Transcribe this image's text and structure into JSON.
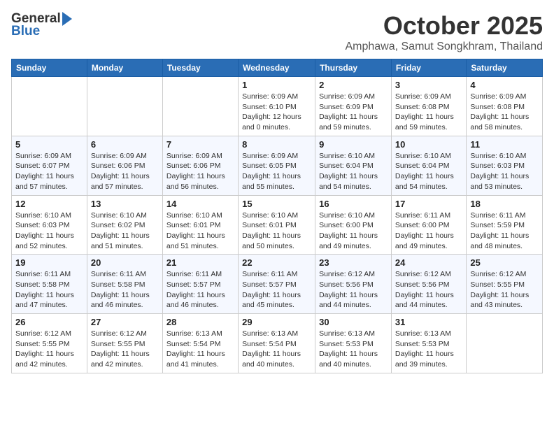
{
  "header": {
    "logo_general": "General",
    "logo_blue": "Blue",
    "month": "October 2025",
    "location": "Amphawa, Samut Songkhram, Thailand"
  },
  "weekdays": [
    "Sunday",
    "Monday",
    "Tuesday",
    "Wednesday",
    "Thursday",
    "Friday",
    "Saturday"
  ],
  "weeks": [
    [
      {
        "day": "",
        "info": ""
      },
      {
        "day": "",
        "info": ""
      },
      {
        "day": "",
        "info": ""
      },
      {
        "day": "1",
        "info": "Sunrise: 6:09 AM\nSunset: 6:10 PM\nDaylight: 12 hours\nand 0 minutes."
      },
      {
        "day": "2",
        "info": "Sunrise: 6:09 AM\nSunset: 6:09 PM\nDaylight: 11 hours\nand 59 minutes."
      },
      {
        "day": "3",
        "info": "Sunrise: 6:09 AM\nSunset: 6:08 PM\nDaylight: 11 hours\nand 59 minutes."
      },
      {
        "day": "4",
        "info": "Sunrise: 6:09 AM\nSunset: 6:08 PM\nDaylight: 11 hours\nand 58 minutes."
      }
    ],
    [
      {
        "day": "5",
        "info": "Sunrise: 6:09 AM\nSunset: 6:07 PM\nDaylight: 11 hours\nand 57 minutes."
      },
      {
        "day": "6",
        "info": "Sunrise: 6:09 AM\nSunset: 6:06 PM\nDaylight: 11 hours\nand 57 minutes."
      },
      {
        "day": "7",
        "info": "Sunrise: 6:09 AM\nSunset: 6:06 PM\nDaylight: 11 hours\nand 56 minutes."
      },
      {
        "day": "8",
        "info": "Sunrise: 6:09 AM\nSunset: 6:05 PM\nDaylight: 11 hours\nand 55 minutes."
      },
      {
        "day": "9",
        "info": "Sunrise: 6:10 AM\nSunset: 6:04 PM\nDaylight: 11 hours\nand 54 minutes."
      },
      {
        "day": "10",
        "info": "Sunrise: 6:10 AM\nSunset: 6:04 PM\nDaylight: 11 hours\nand 54 minutes."
      },
      {
        "day": "11",
        "info": "Sunrise: 6:10 AM\nSunset: 6:03 PM\nDaylight: 11 hours\nand 53 minutes."
      }
    ],
    [
      {
        "day": "12",
        "info": "Sunrise: 6:10 AM\nSunset: 6:03 PM\nDaylight: 11 hours\nand 52 minutes."
      },
      {
        "day": "13",
        "info": "Sunrise: 6:10 AM\nSunset: 6:02 PM\nDaylight: 11 hours\nand 51 minutes."
      },
      {
        "day": "14",
        "info": "Sunrise: 6:10 AM\nSunset: 6:01 PM\nDaylight: 11 hours\nand 51 minutes."
      },
      {
        "day": "15",
        "info": "Sunrise: 6:10 AM\nSunset: 6:01 PM\nDaylight: 11 hours\nand 50 minutes."
      },
      {
        "day": "16",
        "info": "Sunrise: 6:10 AM\nSunset: 6:00 PM\nDaylight: 11 hours\nand 49 minutes."
      },
      {
        "day": "17",
        "info": "Sunrise: 6:11 AM\nSunset: 6:00 PM\nDaylight: 11 hours\nand 49 minutes."
      },
      {
        "day": "18",
        "info": "Sunrise: 6:11 AM\nSunset: 5:59 PM\nDaylight: 11 hours\nand 48 minutes."
      }
    ],
    [
      {
        "day": "19",
        "info": "Sunrise: 6:11 AM\nSunset: 5:58 PM\nDaylight: 11 hours\nand 47 minutes."
      },
      {
        "day": "20",
        "info": "Sunrise: 6:11 AM\nSunset: 5:58 PM\nDaylight: 11 hours\nand 46 minutes."
      },
      {
        "day": "21",
        "info": "Sunrise: 6:11 AM\nSunset: 5:57 PM\nDaylight: 11 hours\nand 46 minutes."
      },
      {
        "day": "22",
        "info": "Sunrise: 6:11 AM\nSunset: 5:57 PM\nDaylight: 11 hours\nand 45 minutes."
      },
      {
        "day": "23",
        "info": "Sunrise: 6:12 AM\nSunset: 5:56 PM\nDaylight: 11 hours\nand 44 minutes."
      },
      {
        "day": "24",
        "info": "Sunrise: 6:12 AM\nSunset: 5:56 PM\nDaylight: 11 hours\nand 44 minutes."
      },
      {
        "day": "25",
        "info": "Sunrise: 6:12 AM\nSunset: 5:55 PM\nDaylight: 11 hours\nand 43 minutes."
      }
    ],
    [
      {
        "day": "26",
        "info": "Sunrise: 6:12 AM\nSunset: 5:55 PM\nDaylight: 11 hours\nand 42 minutes."
      },
      {
        "day": "27",
        "info": "Sunrise: 6:12 AM\nSunset: 5:55 PM\nDaylight: 11 hours\nand 42 minutes."
      },
      {
        "day": "28",
        "info": "Sunrise: 6:13 AM\nSunset: 5:54 PM\nDaylight: 11 hours\nand 41 minutes."
      },
      {
        "day": "29",
        "info": "Sunrise: 6:13 AM\nSunset: 5:54 PM\nDaylight: 11 hours\nand 40 minutes."
      },
      {
        "day": "30",
        "info": "Sunrise: 6:13 AM\nSunset: 5:53 PM\nDaylight: 11 hours\nand 40 minutes."
      },
      {
        "day": "31",
        "info": "Sunrise: 6:13 AM\nSunset: 5:53 PM\nDaylight: 11 hours\nand 39 minutes."
      },
      {
        "day": "",
        "info": ""
      }
    ]
  ]
}
